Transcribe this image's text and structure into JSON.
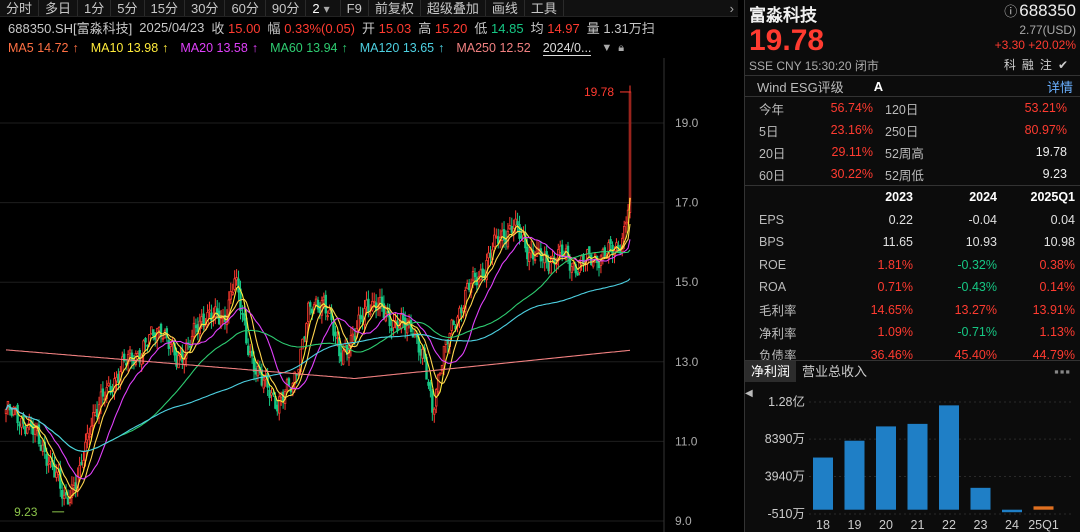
{
  "toolbar": {
    "items": [
      "分时",
      "多日",
      "1分",
      "5分",
      "15分",
      "30分",
      "60分",
      "90分",
      "2",
      "F9",
      "前复权",
      "超级叠加",
      "画线",
      "工具"
    ],
    "more_icon": "chevron-right-icon",
    "dropdown_icon": "chevron-down-icon"
  },
  "quote": {
    "code": "688350.SH[富淼科技]",
    "date": "2025/04/23",
    "close_label": "收",
    "close": "15.00",
    "change_label": "幅",
    "change": "0.33%(0.05)",
    "open_label": "开",
    "open": "15.03",
    "high_label": "高",
    "high": "15.20",
    "low_label": "低",
    "low": "14.85",
    "avg_label": "均",
    "avg": "14.97",
    "volume_label": "量",
    "volume": "1.31万",
    "extra": "扫"
  },
  "ma_legend": [
    {
      "name": "MA5",
      "value": "14.72",
      "arrow": "↑",
      "color": "#ff7043"
    },
    {
      "name": "MA10",
      "value": "13.98",
      "arrow": "↑",
      "color": "#ffeb3b"
    },
    {
      "name": "MA20",
      "value": "13.58",
      "arrow": "↑",
      "color": "#e040fb"
    },
    {
      "name": "MA60",
      "value": "13.94",
      "arrow": "↑",
      "color": "#2ecc71"
    },
    {
      "name": "MA120",
      "value": "13.65",
      "arrow": "↑",
      "color": "#4dd0e1"
    },
    {
      "name": "MA250",
      "value": "12.52",
      "arrow": "↑",
      "color": "#f08080"
    }
  ],
  "ma_date": "2024/0...",
  "price_axis": [
    "19.0",
    "17.0",
    "15.0",
    "13.0",
    "11.0",
    "9.0"
  ],
  "annotations": {
    "high": "19.78",
    "low": "9.23"
  },
  "colors": {
    "up": "#ff3b30",
    "down": "#16c784",
    "up_bar": "#ff3b30",
    "down_bar": "#16c784"
  },
  "panel": {
    "name": "富淼科技",
    "code_icon": "info-circle-icon",
    "code": "688350",
    "price": "19.78",
    "change_pts": "2.77(USD)",
    "change": "+3.30  +20.02%",
    "meta": "SSE  CNY  15:30:20  闭市",
    "tags": [
      "科",
      "融",
      "注",
      "✔"
    ],
    "esg_label": "Wind ESG评级",
    "esg_value": "A",
    "esg_detail": "详情"
  },
  "returns": [
    {
      "k": "今年",
      "v": "56.74%",
      "k2": "120日",
      "v2": "53.21%",
      "v2color": "#ff3b30"
    },
    {
      "k": "5日",
      "v": "23.16%",
      "k2": "250日",
      "v2": "80.97%",
      "v2color": "#ff3b30"
    },
    {
      "k": "20日",
      "v": "29.11%",
      "k2": "52周高",
      "v2": "19.78",
      "v2color": "#eeeeee"
    },
    {
      "k": "60日",
      "v": "30.22%",
      "k2": "52周低",
      "v2": "9.23",
      "v2color": "#eeeeee"
    }
  ],
  "financials": {
    "headers": [
      "",
      "2023",
      "2024",
      "2025Q1"
    ],
    "rows": [
      {
        "label": "EPS",
        "values": [
          "0.22",
          "-0.04",
          "0.04"
        ],
        "colors": [
          "#e0e0e0",
          "#e0e0e0",
          "#e0e0e0"
        ]
      },
      {
        "label": "BPS",
        "values": [
          "11.65",
          "10.93",
          "10.98"
        ],
        "colors": [
          "#e0e0e0",
          "#e0e0e0",
          "#e0e0e0"
        ]
      },
      {
        "label": "ROE",
        "values": [
          "1.81%",
          "-0.32%",
          "0.38%"
        ],
        "colors": [
          "#ff3b30",
          "#16c784",
          "#ff3b30"
        ]
      },
      {
        "label": "ROA",
        "values": [
          "0.71%",
          "-0.43%",
          "0.14%"
        ],
        "colors": [
          "#ff3b30",
          "#16c784",
          "#ff3b30"
        ]
      },
      {
        "label": "毛利率",
        "values": [
          "14.65%",
          "13.27%",
          "13.91%"
        ],
        "colors": [
          "#ff3b30",
          "#ff3b30",
          "#ff3b30"
        ]
      },
      {
        "label": "净利率",
        "values": [
          "1.09%",
          "-0.71%",
          "1.13%"
        ],
        "colors": [
          "#ff3b30",
          "#16c784",
          "#ff3b30"
        ]
      },
      {
        "label": "负债率",
        "values": [
          "36.46%",
          "45.40%",
          "44.79%"
        ],
        "colors": [
          "#ff3b30",
          "#ff3b30",
          "#ff3b30"
        ]
      }
    ]
  },
  "tabs": [
    "净利润",
    "营业总收入"
  ],
  "tab_more_icon": "more-dots-icon",
  "chart_data": [
    {
      "type": "bar",
      "title": "净利润",
      "categories": [
        "18",
        "19",
        "20",
        "21",
        "22",
        "23",
        "24",
        "25Q1"
      ],
      "values": [
        62000000,
        82000000,
        99000000,
        102000000,
        124000000,
        26000000,
        -3000000,
        4000000
      ],
      "y_ticks": [
        "1.28亿",
        "8390万",
        "3940万",
        "-510万"
      ],
      "ylim": [
        -5100000,
        128000000
      ],
      "colors": [
        "#1f7fc6",
        "#1f7fc6",
        "#1f7fc6",
        "#1f7fc6",
        "#1f7fc6",
        "#1f7fc6",
        "#1f7fc6",
        "#e07020"
      ]
    }
  ]
}
